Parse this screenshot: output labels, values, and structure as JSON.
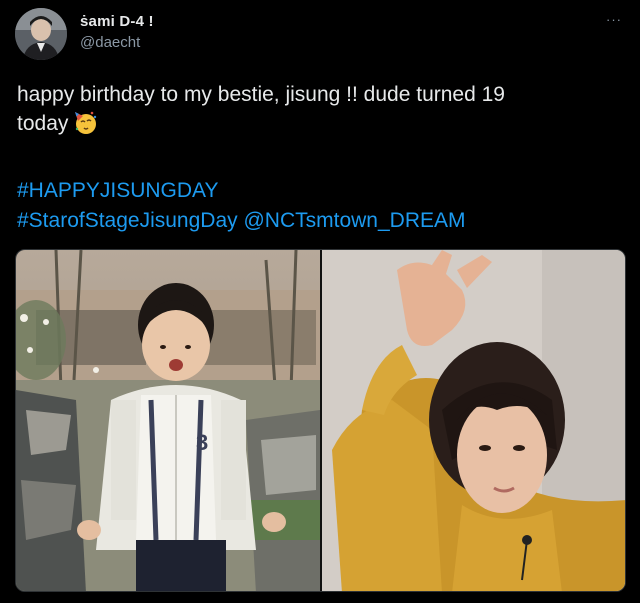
{
  "tweet": {
    "display_name": "ṡami D-4 !",
    "handle": "@daecht",
    "more_glyph": "···",
    "text_line1": "happy birthday to my bestie, jisung !! dude turned 19",
    "text_line2": "today",
    "hashtag1": "#HAPPYJISUNGDAY",
    "hashtag2": "#StarofStageJisungDay",
    "mention": "@NCTsmtown_DREAM",
    "emoji": "partying-face-emoji"
  },
  "colors": {
    "background": "#000000",
    "text": "#e7e9ea",
    "secondary": "#8b98a5",
    "link": "#1d9bf0"
  },
  "media": {
    "count": 2,
    "left_photo": "child-photo",
    "right_photo": "yellow-hoodie-photo"
  }
}
